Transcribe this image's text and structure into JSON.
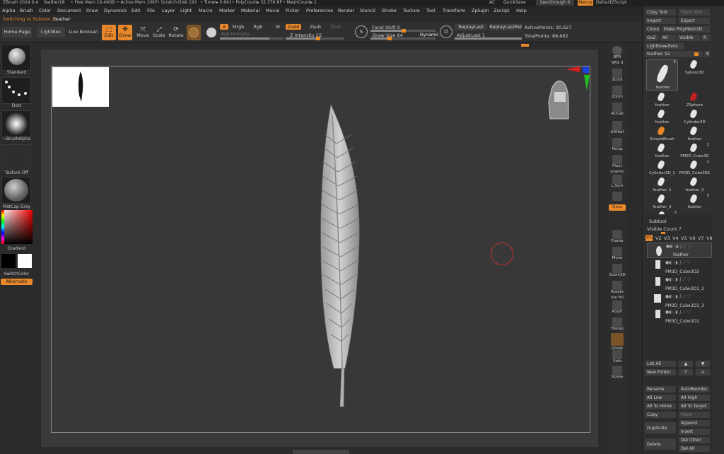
{
  "titlebar": {
    "app": "ZBrush 2024.0.4",
    "doc": "feather18",
    "free_mem": "• Free Mem 16.49GB",
    "active_mem": "• Active Mem 1067",
    "scratch": "• Scratch Disk 193",
    "timer": "• Timer▸ 0.641",
    "polycount": "• PolyCount▸ 32.376 KP",
    "meshcount": "• MeshCount▸ 1",
    "ac": "AC",
    "quicksave": "QuickSave",
    "seethrough": "See-through  0",
    "menus": "Menus",
    "defaultzscript": "DefaultZScript"
  },
  "menu": [
    "Alpha",
    "Brush",
    "Color",
    "Document",
    "Draw",
    "Dynamics",
    "Edit",
    "File",
    "Layer",
    "Light",
    "Macro",
    "Marker",
    "Material",
    "Movie",
    "Picker",
    "Preferences",
    "Render",
    "Stencil",
    "Stroke",
    "Texture",
    "Tool",
    "Transform",
    "Zplugin",
    "Zscript",
    "Help"
  ],
  "status": {
    "prefix": "Switching to Subtool 1:",
    "name": "feather"
  },
  "topshelf": {
    "home": "Home Page",
    "lightbox": "LightBox",
    "liveboolean": "Live Boolean",
    "edit": "Edit",
    "draw": "Draw",
    "move": "Move",
    "scale": "Scale",
    "rotate": "Rotate",
    "a": "A",
    "mrgb": "Mrgb",
    "rgb": "Rgb",
    "m": "M",
    "zadd": "Zadd",
    "zsub": "Zsub",
    "zcut": "Zcut",
    "rgb_intensity": "Rgb Intensity",
    "z_intensity": "Z Intensity 25",
    "focal_shift": "Focal Shift 0",
    "draw_size": "Draw Size 64",
    "dynamic": "Dynamic",
    "replaylast": "ReplayLast",
    "replaylastrel": "ReplayLastRel",
    "adjustlast": "AdjustLast  1",
    "activepoints": "ActivePoints: 30,627",
    "totalpoints": "TotalPoints: 88,662"
  },
  "leftshelf": {
    "standard": "Standard",
    "dots": "Dots",
    "brushalpha": "~BrushAlpha",
    "textureoff": "Texture Off",
    "matcap": "MatCap Gray",
    "gradient": "Gradient",
    "switchcolor": "SwitchColor",
    "alternate": "Alternate"
  },
  "rightshelf": {
    "bpr": "BPR",
    "spix": "SPix 3",
    "scroll": "Scroll",
    "zoom": "Zoom",
    "actual": "Actual",
    "aahalf": "AAHalf",
    "persp": "Persp",
    "floor": "Floor",
    "dynamic": "ynamic",
    "lsym": "L.Sym",
    "qxyz": "Qxyz",
    "frame": "Frame",
    "move": "Move",
    "zoom3d": "Zoom3D",
    "rotate": "Rotate",
    "linefill": "ine Fill",
    "polyf": "PolyF",
    "transp": "Transp",
    "ghost": "Ghost",
    "solo": "Solo",
    "xpose": "Xpose"
  },
  "tool_palette": {
    "copytool": "Copy Tool",
    "pastetool": "Paste Tool",
    "import": "Import",
    "export": "Export",
    "clone": "Clone",
    "makepolymesh": "Make PolyMesh3D",
    "goz": "GoZ",
    "all": "All",
    "visible": "Visible",
    "r": "R",
    "lightbox_tools": "Lightbox▸Tools",
    "feather_slider": "feather. 52",
    "tools": [
      {
        "label": "feather",
        "badge": "5"
      },
      {
        "label": "Sphere3D",
        "badge": ""
      },
      {
        "label": "feather",
        "badge": ""
      },
      {
        "label": "ZSphere",
        "badge": ""
      },
      {
        "label": "feather",
        "badge": ""
      },
      {
        "label": "Cylinder3D",
        "badge": ""
      },
      {
        "label": "SimpleBrush",
        "badge": ""
      },
      {
        "label": "feather",
        "badge": ""
      },
      {
        "label": "feather",
        "badge": ""
      },
      {
        "label": "PM3D_Cube3D",
        "badge": "2"
      },
      {
        "label": "Cylinder3D_1",
        "badge": ""
      },
      {
        "label": "PM3D_Cube3D1",
        "badge": "2"
      },
      {
        "label": "feather_1",
        "badge": ""
      },
      {
        "label": "feather_2",
        "badge": ""
      },
      {
        "label": "feather_3",
        "badge": ""
      },
      {
        "label": "feather",
        "badge": "5"
      },
      {
        "label": "PM3D_Cube3D1",
        "badge": "3"
      }
    ]
  },
  "subtool": {
    "header": "Subtool",
    "visible_count": "Visible Count 7",
    "tabs": [
      "V1",
      "V2",
      "V3",
      "V4",
      "V5",
      "V6",
      "V7",
      "V8"
    ],
    "items": [
      "feather",
      "PM3D_Cube3D2",
      "PM3D_Cube3D1_2",
      "PM3D_Cube3D1_3",
      "PM3D_Cube3D1"
    ],
    "listall": "List All",
    "newfolder": "New Folder",
    "rename": "Rename",
    "autoreorder": "AutoReorder",
    "alllow": "All Low",
    "allhigh": "All High",
    "alltohome": "All To Home",
    "alltotarget": "All To Target",
    "copy": "Copy",
    "paste": "Paste",
    "duplicate": "Duplicate",
    "append": "Append",
    "insert": "Insert",
    "delete": "Delete",
    "delother": "Del Other",
    "delall": "Del All"
  },
  "colors": {
    "accent": "#e8882a",
    "panel": "#2f2f2f",
    "canvas": "#383838"
  }
}
